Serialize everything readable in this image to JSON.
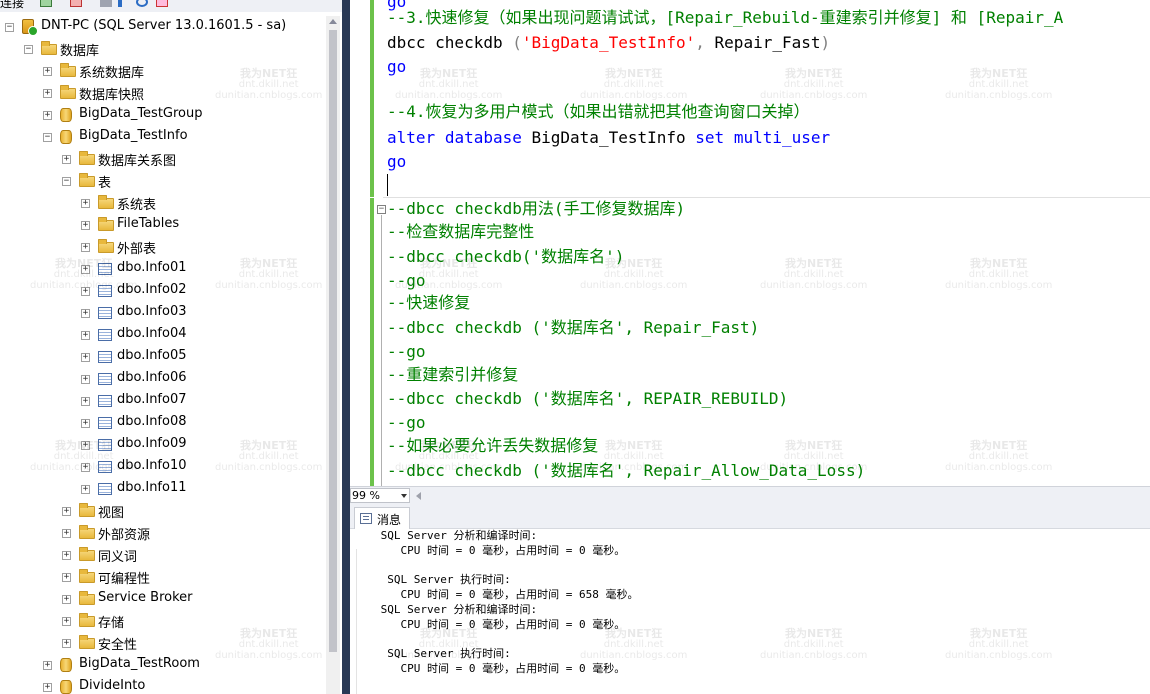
{
  "object_explorer": {
    "toolbar_label": "连接",
    "nodes": [
      {
        "label": "DNT-PC (SQL Server 13.0.1601.5 - sa)",
        "icon": "server-icon",
        "expander": "−"
      },
      {
        "label": "数据库",
        "icon": "folder-icon",
        "expander": "−"
      },
      {
        "label": "系统数据库",
        "icon": "folder-icon",
        "expander": "+"
      },
      {
        "label": "数据库快照",
        "icon": "folder-icon",
        "expander": "+"
      },
      {
        "label": "BigData_TestGroup",
        "icon": "database-icon",
        "expander": "+"
      },
      {
        "label": "BigData_TestInfo",
        "icon": "database-icon",
        "expander": "−"
      },
      {
        "label": "数据库关系图",
        "icon": "folder-icon",
        "expander": "+"
      },
      {
        "label": "表",
        "icon": "folder-icon",
        "expander": "−"
      },
      {
        "label": "系统表",
        "icon": "folder-icon",
        "expander": "+"
      },
      {
        "label": "FileTables",
        "icon": "folder-icon",
        "expander": "+"
      },
      {
        "label": "外部表",
        "icon": "folder-icon",
        "expander": "+"
      },
      {
        "label": "dbo.Info01",
        "icon": "table-icon",
        "expander": "+"
      },
      {
        "label": "dbo.Info02",
        "icon": "table-icon",
        "expander": "+"
      },
      {
        "label": "dbo.Info03",
        "icon": "table-icon",
        "expander": "+"
      },
      {
        "label": "dbo.Info04",
        "icon": "table-icon",
        "expander": "+"
      },
      {
        "label": "dbo.Info05",
        "icon": "table-icon",
        "expander": "+"
      },
      {
        "label": "dbo.Info06",
        "icon": "table-icon",
        "expander": "+"
      },
      {
        "label": "dbo.Info07",
        "icon": "table-icon",
        "expander": "+"
      },
      {
        "label": "dbo.Info08",
        "icon": "table-icon",
        "expander": "+"
      },
      {
        "label": "dbo.Info09",
        "icon": "table-icon",
        "expander": "+"
      },
      {
        "label": "dbo.Info10",
        "icon": "table-icon",
        "expander": "+"
      },
      {
        "label": "dbo.Info11",
        "icon": "table-icon",
        "expander": "+"
      },
      {
        "label": "视图",
        "icon": "folder-icon",
        "expander": "+"
      },
      {
        "label": "外部资源",
        "icon": "folder-icon",
        "expander": "+"
      },
      {
        "label": "同义词",
        "icon": "folder-icon",
        "expander": "+"
      },
      {
        "label": "可编程性",
        "icon": "folder-icon",
        "expander": "+"
      },
      {
        "label": "Service Broker",
        "icon": "folder-icon",
        "expander": "+"
      },
      {
        "label": "存储",
        "icon": "folder-icon",
        "expander": "+"
      },
      {
        "label": "安全性",
        "icon": "folder-icon",
        "expander": "+"
      },
      {
        "label": "BigData_TestRoom",
        "icon": "database-icon",
        "expander": "+"
      },
      {
        "label": "DivideInto",
        "icon": "database-icon",
        "expander": "+"
      }
    ]
  },
  "editor": {
    "lines": [
      [
        {
          "t": "go",
          "c": "kw"
        }
      ],
      [
        {
          "t": "--3.快速修复（如果出现问题请试试，[Repair_Rebuild-重建索引并修复] 和 [Repair_A",
          "c": "cm"
        }
      ],
      [
        {
          "t": "dbcc",
          "c": "tx"
        },
        {
          "t": " checkdb ",
          "c": "tx"
        },
        {
          "t": "(",
          "c": "gy"
        },
        {
          "t": "'BigData_TestInfo'",
          "c": "str"
        },
        {
          "t": ",",
          "c": "gy"
        },
        {
          "t": " Repair_Fast",
          "c": "tx"
        },
        {
          "t": ")",
          "c": "gy"
        }
      ],
      [
        {
          "t": "go",
          "c": "kw"
        }
      ],
      [],
      [
        {
          "t": "--4.恢复为多用户模式（如果出错就把其他查询窗口关掉）",
          "c": "cm"
        }
      ],
      [
        {
          "t": "alter",
          "c": "kw"
        },
        {
          "t": " ",
          "c": "tx"
        },
        {
          "t": "database",
          "c": "kw"
        },
        {
          "t": " BigData_TestInfo ",
          "c": "tx"
        },
        {
          "t": "set",
          "c": "kw"
        },
        {
          "t": " ",
          "c": "tx"
        },
        {
          "t": "multi_user",
          "c": "kw"
        }
      ],
      [
        {
          "t": "go",
          "c": "kw"
        }
      ],
      [],
      [
        {
          "t": "--dbcc checkdb用法(手工修复数据库)",
          "c": "cm"
        }
      ],
      [
        {
          "t": "--检查数据库完整性",
          "c": "cm"
        }
      ],
      [
        {
          "t": "--dbcc checkdb('数据库名')",
          "c": "cm"
        }
      ],
      [
        {
          "t": "--go",
          "c": "cm"
        }
      ],
      [
        {
          "t": "--快速修复",
          "c": "cm"
        }
      ],
      [
        {
          "t": "--dbcc checkdb ('数据库名', Repair_Fast)",
          "c": "cm"
        }
      ],
      [
        {
          "t": "--go",
          "c": "cm"
        }
      ],
      [
        {
          "t": "--重建索引并修复",
          "c": "cm"
        }
      ],
      [
        {
          "t": "--dbcc checkdb ('数据库名', REPAIR_REBUILD)",
          "c": "cm"
        }
      ],
      [
        {
          "t": "--go",
          "c": "cm"
        }
      ],
      [
        {
          "t": "--如果必要允许丢失数据修复",
          "c": "cm"
        }
      ],
      [
        {
          "t": "--dbcc checkdb ('数据库名', Repair_Allow_Data_Loss)",
          "c": "cm"
        }
      ]
    ],
    "fold_symbol": "−"
  },
  "zoom": {
    "value": "99 %"
  },
  "results": {
    "tab_label": "消息",
    "lines": [
      " SQL Server 分析和编译时间:",
      "    CPU 时间 = 0 毫秒，占用时间 = 0 毫秒。",
      "",
      "  SQL Server 执行时间:",
      "    CPU 时间 = 0 毫秒，占用时间 = 658 毫秒。",
      " SQL Server 分析和编译时间:",
      "    CPU 时间 = 0 毫秒，占用时间 = 0 毫秒。",
      "",
      "  SQL Server 执行时间:",
      "    CPU 时间 = 0 毫秒，占用时间 = 0 毫秒。"
    ]
  },
  "watermark": {
    "line1": "我为NET狂",
    "line2": "dnt.dkill.net",
    "line3": "dunitian.cnblogs.com"
  },
  "colors": {
    "comment": "#008000",
    "keyword": "#0000ff",
    "string": "#ff0000",
    "change_bar": "#6cc24a",
    "divider": "#293955"
  }
}
